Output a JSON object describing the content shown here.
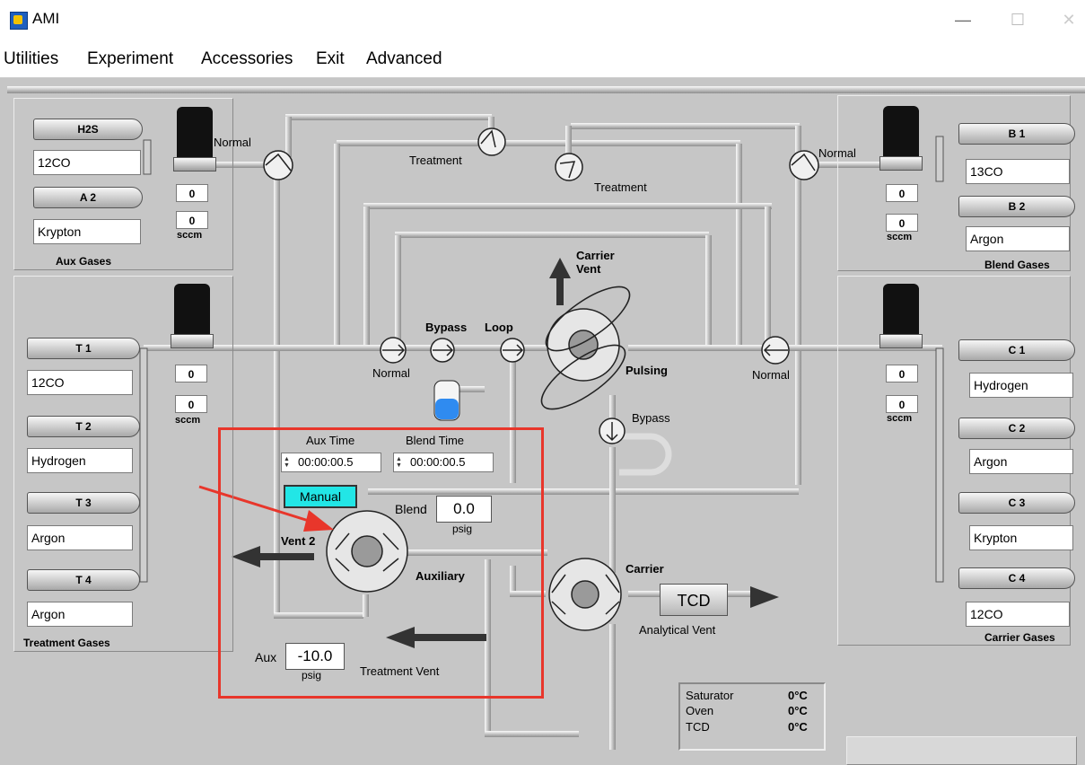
{
  "window": {
    "title": "AMI",
    "minimize": "—",
    "maximize": "☐",
    "close": "✕"
  },
  "menu": [
    "Utilities",
    "Experiment",
    "Accessories",
    "Exit",
    "Advanced"
  ],
  "aux_gases": {
    "caption": "Aux Gases",
    "cylinders": [
      {
        "label": "H2S",
        "gas": "12CO"
      },
      {
        "label": "A 2",
        "gas": "Krypton"
      }
    ],
    "flows": [
      "0",
      "0"
    ],
    "unit": "sccm",
    "valve_label": "Normal"
  },
  "treatment_gases": {
    "caption": "Treatment Gases",
    "cylinders": [
      {
        "label": "T 1",
        "gas": "12CO"
      },
      {
        "label": "T 2",
        "gas": "Hydrogen"
      },
      {
        "label": "T 3",
        "gas": "Argon"
      },
      {
        "label": "T 4",
        "gas": "Argon"
      }
    ],
    "flows": [
      "0",
      "0"
    ],
    "unit": "sccm"
  },
  "blend_gases": {
    "caption": "Blend Gases",
    "cylinders": [
      {
        "label": "B 1",
        "gas": "13CO"
      },
      {
        "label": "B 2",
        "gas": "Argon"
      }
    ],
    "flows": [
      "0",
      "0"
    ],
    "unit": "sccm",
    "valve_label": "Normal"
  },
  "carrier_gases": {
    "caption": "Carrier Gases",
    "cylinders": [
      {
        "label": "C 1",
        "gas": "Hydrogen"
      },
      {
        "label": "C 2",
        "gas": "Argon"
      },
      {
        "label": "C 3",
        "gas": "Krypton"
      },
      {
        "label": "C 4",
        "gas": "12CO"
      }
    ],
    "flows": [
      "0",
      "0"
    ],
    "unit": "sccm"
  },
  "flow": {
    "treatment_1": "Treatment",
    "treatment_2": "Treatment",
    "carrier_vent": "Carrier\nVent",
    "bypass": "Bypass",
    "loop": "Loop",
    "pulsing": "Pulsing",
    "normal_left": "Normal",
    "normal_right": "Normal",
    "bypass_lower": "Bypass",
    "vent2": "Vent 2",
    "auxiliary": "Auxiliary",
    "carrier": "Carrier",
    "tcd": "TCD",
    "analytical_vent": "Analytical Vent",
    "treatment_vent": "Treatment Vent"
  },
  "controls": {
    "aux_time_label": "Aux Time",
    "aux_time": "00:00:00.5",
    "blend_time_label": "Blend Time",
    "blend_time": "00:00:00.5",
    "manual": "Manual",
    "blend_label": "Blend",
    "blend_value": "0.0",
    "blend_unit": "psig",
    "aux_label": "Aux",
    "aux_value": "-10.0",
    "aux_unit": "psig"
  },
  "temperatures": [
    {
      "name": "Saturator",
      "value": "0°C"
    },
    {
      "name": "Oven",
      "value": "0°C"
    },
    {
      "name": "TCD",
      "value": "0°C"
    }
  ]
}
